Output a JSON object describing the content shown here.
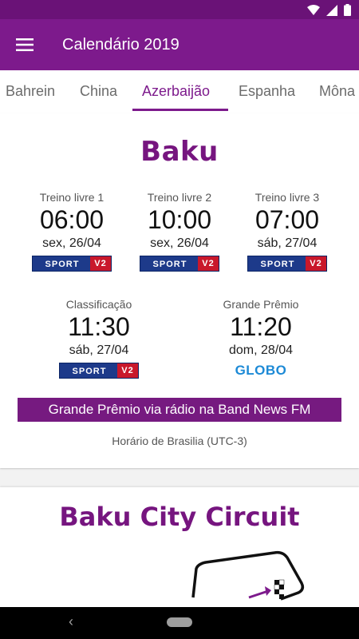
{
  "app": {
    "title": "Calendário 2019"
  },
  "tabs": [
    {
      "label": "Bahrein"
    },
    {
      "label": "China"
    },
    {
      "label": "Azerbaijão"
    },
    {
      "label": "Espanha"
    },
    {
      "label": "Môna"
    }
  ],
  "active_tab": "Azerbaijão",
  "race": {
    "city": "Baku",
    "sessions": [
      {
        "label": "Treino livre 1",
        "time": "06:00",
        "date": "sex, 26/04",
        "channel": "SPORTV2"
      },
      {
        "label": "Treino livre 2",
        "time": "10:00",
        "date": "sex, 26/04",
        "channel": "SPORTV2"
      },
      {
        "label": "Treino livre 3",
        "time": "07:00",
        "date": "sáb, 27/04",
        "channel": "SPORTV2"
      },
      {
        "label": "Classificação",
        "time": "11:30",
        "date": "sáb, 27/04",
        "channel": "SPORTV2"
      },
      {
        "label": "Grande Prêmio",
        "time": "11:20",
        "date": "dom, 28/04",
        "channel": "GLOBO"
      }
    ],
    "radio_banner": "Grande Prêmio via rádio na Band News FM",
    "timezone": "Horário de Brasilia (UTC-3)"
  },
  "sportv": {
    "sport": "SPORT",
    "v2": "V2"
  },
  "circuit": {
    "title": "Baku City Circuit"
  },
  "colors": {
    "primary": "#7d1a8c",
    "primary_dark": "#6a1277",
    "title": "#76157f",
    "sportv_blue": "#1d3a8a",
    "sportv_red": "#c9182b",
    "globo_blue": "#1d8ad6"
  }
}
